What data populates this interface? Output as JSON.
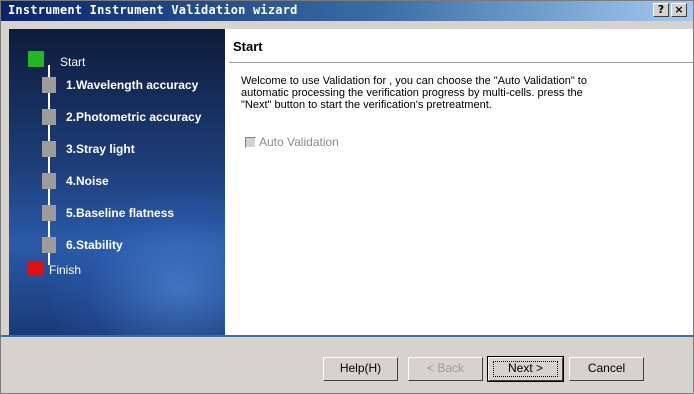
{
  "window": {
    "title": "Instrument Instrument Validation wizard"
  },
  "titlebar": {
    "help_glyph": "?",
    "close_glyph": "×"
  },
  "sidebar": {
    "start_label": "Start",
    "finish_label": "Finish",
    "steps": [
      "1.Wavelength accuracy",
      "2.Photometric accuracy",
      "3.Stray light",
      "4.Noise",
      "5.Baseline flatness",
      "6.Stability"
    ]
  },
  "main": {
    "heading": "Start",
    "welcome_text": "Welcome to use Validation for ,  you can choose the \"Auto Validation\" to automatic processing the verification progress by multi-cells. press the \"Next\" button to start the verification's pretreatment.",
    "auto_validation_label": "Auto Validation",
    "auto_validation_checked": false
  },
  "buttons": {
    "help": "Help(H)",
    "back": "< Back",
    "next": "Next >",
    "cancel": "Cancel"
  },
  "colors": {
    "start": "#23b823",
    "finish": "#e01010",
    "pending": "#9c9c9c",
    "titlebar": "#0a246a"
  }
}
